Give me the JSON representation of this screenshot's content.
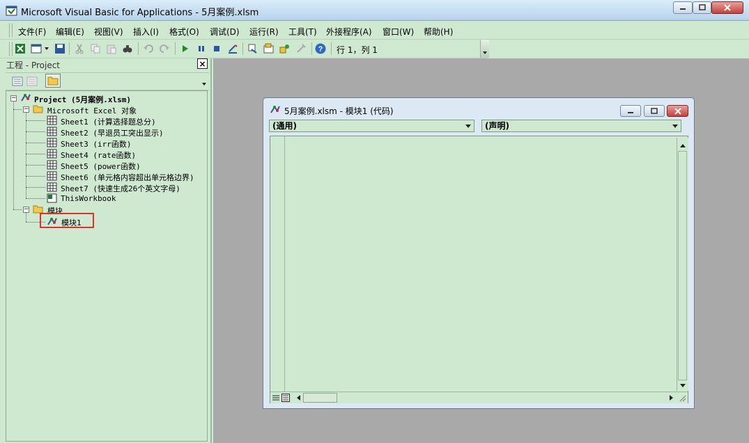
{
  "window": {
    "title": "Microsoft Visual Basic for Applications - 5月案例.xlsm"
  },
  "menu": {
    "items": [
      "文件(F)",
      "编辑(E)",
      "视图(V)",
      "插入(I)",
      "格式(O)",
      "调试(D)",
      "运行(R)",
      "工具(T)",
      "外接程序(A)",
      "窗口(W)",
      "帮助(H)"
    ]
  },
  "toolbar": {
    "position": "行 1，列 1"
  },
  "project": {
    "title": "工程 - Project",
    "close": "×",
    "root": "Project (5月案例.xlsm)",
    "excel_objects": "Microsoft Excel 对象",
    "sheets": [
      "Sheet1 (计算选择题总分)",
      "Sheet2 (早退员工突出显示)",
      "Sheet3 (irr函数)",
      "Sheet4 (rate函数)",
      "Sheet5 (power函数)",
      "Sheet6 (单元格内容超出单元格边界)",
      "Sheet7 (快速生成26个英文字母)",
      "ThisWorkbook"
    ],
    "modules_folder": "模块",
    "module": "模块1"
  },
  "code_window": {
    "title": "5月案例.xlsm - 模块1 (代码)",
    "object_combo": "(通用)",
    "procedure_combo": "(声明)"
  },
  "colors": {
    "background": "#cfe8d0",
    "highlight_box": "#e0302b",
    "mdi_background": "#a9a9a9"
  }
}
